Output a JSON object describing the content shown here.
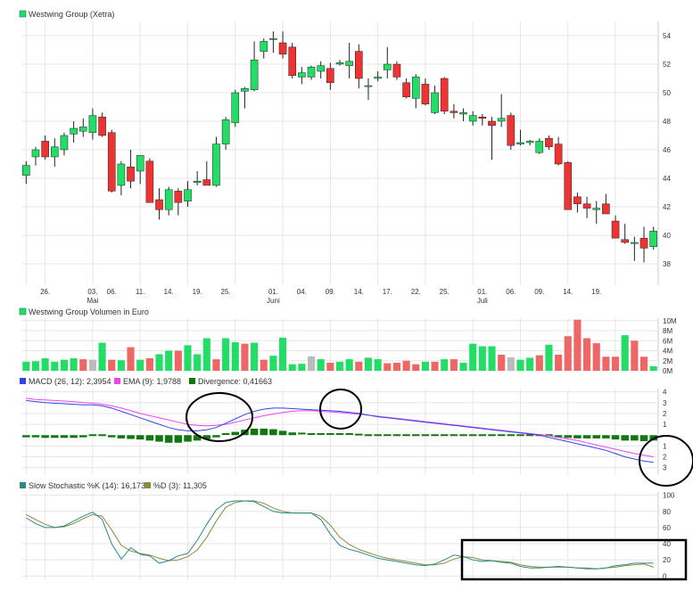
{
  "colors": {
    "up": "#22dd66",
    "down": "#ee3333",
    "neutral": "#bbbbbb",
    "grid": "#e6e6e6",
    "axis_text": "#333333",
    "macd_line": "#3344ee",
    "ema_line": "#ee44ee",
    "divergence": "#117711",
    "stoch_k": "#2a8a8a",
    "stoch_d": "#8a8a3a",
    "annotation": "#000000"
  },
  "price": {
    "title": "Westwing Group (Xetra)",
    "ylim": [
      36.5,
      55
    ],
    "yticks": [
      "38",
      "40",
      "42",
      "44",
      "46",
      "48",
      "50",
      "52",
      "54"
    ],
    "ytick_values": [
      38,
      40,
      42,
      44,
      46,
      48,
      50,
      52,
      54
    ],
    "xlabels": [
      {
        "label": "26.",
        "i": 2
      },
      {
        "label": "03.",
        "i": 7
      },
      {
        "label": "06.",
        "i": 9
      },
      {
        "label": "11.",
        "i": 12
      },
      {
        "label": "14.",
        "i": 15
      },
      {
        "label": "19.",
        "i": 18
      },
      {
        "label": "25.",
        "i": 21
      },
      {
        "label": "01.",
        "i": 26
      },
      {
        "label": "04.",
        "i": 29
      },
      {
        "label": "09.",
        "i": 32
      },
      {
        "label": "14.",
        "i": 35
      },
      {
        "label": "17.",
        "i": 38
      },
      {
        "label": "22.",
        "i": 41
      },
      {
        "label": "25.",
        "i": 44
      },
      {
        "label": "01.",
        "i": 48
      },
      {
        "label": "06.",
        "i": 51
      },
      {
        "label": "09.",
        "i": 54
      },
      {
        "label": "14.",
        "i": 57
      },
      {
        "label": "19.",
        "i": 60
      }
    ],
    "month_labels": [
      {
        "label": "Mai",
        "i": 7
      },
      {
        "label": "Juni",
        "i": 26
      },
      {
        "label": "Juli",
        "i": 48
      }
    ]
  },
  "volume": {
    "title": "Westwing Group Volumen in Euro",
    "yticks": [
      "10M",
      "8M",
      "6M",
      "4M",
      "2M",
      "0M"
    ],
    "ytick_values": [
      10,
      8,
      6,
      4,
      2,
      0
    ],
    "ylim": [
      0,
      10.5
    ]
  },
  "macd": {
    "title_macd": "MACD (26, 12): 2,3954",
    "title_ema": "EMA (9): 1,9788",
    "title_div": "Divergence: 0,41663",
    "yticks": [
      "4",
      "3",
      "2",
      "1",
      "1",
      "2",
      "3"
    ],
    "ytick_values": [
      4,
      3,
      2,
      1,
      -1,
      -2,
      -3
    ],
    "ylim": [
      -3.6,
      4.3
    ]
  },
  "stoch": {
    "title_k": "Slow Stochastic %K (14): 16,173",
    "title_d": "%D (3): 11,305",
    "yticks": [
      "100",
      "80",
      "60",
      "40",
      "20",
      "0"
    ],
    "ytick_values": [
      100,
      80,
      60,
      40,
      20,
      0
    ],
    "ylim": [
      -4,
      104
    ]
  },
  "chart_data": {
    "type": "candlestick",
    "title": "Westwing Group (Xetra)",
    "ylim": [
      36.5,
      55
    ],
    "candles": [
      {
        "o": 44.2,
        "h": 45.2,
        "l": 43.6,
        "c": 44.9
      },
      {
        "o": 45.5,
        "h": 46.2,
        "l": 44.9,
        "c": 46.0
      },
      {
        "o": 46.6,
        "h": 47.0,
        "l": 45.3,
        "c": 45.5
      },
      {
        "o": 45.5,
        "h": 46.8,
        "l": 44.8,
        "c": 46.2
      },
      {
        "o": 46.0,
        "h": 47.2,
        "l": 45.6,
        "c": 47.0
      },
      {
        "o": 47.1,
        "h": 48.0,
        "l": 46.5,
        "c": 47.5
      },
      {
        "o": 47.3,
        "h": 48.2,
        "l": 46.9,
        "c": 47.6
      },
      {
        "o": 47.2,
        "h": 48.9,
        "l": 46.7,
        "c": 48.4
      },
      {
        "o": 48.3,
        "h": 48.6,
        "l": 46.9,
        "c": 47.0
      },
      {
        "o": 47.2,
        "h": 47.4,
        "l": 43.0,
        "c": 43.1
      },
      {
        "o": 43.5,
        "h": 45.2,
        "l": 42.8,
        "c": 45.0
      },
      {
        "o": 44.8,
        "h": 46.0,
        "l": 43.3,
        "c": 43.8
      },
      {
        "o": 44.5,
        "h": 45.6,
        "l": 43.6,
        "c": 45.6
      },
      {
        "o": 45.2,
        "h": 45.4,
        "l": 42.4,
        "c": 42.3
      },
      {
        "o": 42.5,
        "h": 43.3,
        "l": 41.1,
        "c": 41.8
      },
      {
        "o": 41.8,
        "h": 43.4,
        "l": 41.4,
        "c": 43.2
      },
      {
        "o": 43.1,
        "h": 43.3,
        "l": 41.4,
        "c": 42.3
      },
      {
        "o": 42.4,
        "h": 43.8,
        "l": 42.0,
        "c": 43.2
      },
      {
        "o": 43.7,
        "h": 44.5,
        "l": 43.5,
        "c": 43.8
      },
      {
        "o": 43.9,
        "h": 45.2,
        "l": 43.5,
        "c": 43.5
      },
      {
        "o": 43.5,
        "h": 46.9,
        "l": 43.4,
        "c": 46.4
      },
      {
        "o": 46.4,
        "h": 48.3,
        "l": 46.0,
        "c": 48.1
      },
      {
        "o": 47.9,
        "h": 50.2,
        "l": 47.6,
        "c": 50.0
      },
      {
        "o": 50.1,
        "h": 50.4,
        "l": 48.9,
        "c": 50.3
      },
      {
        "o": 50.2,
        "h": 53.6,
        "l": 50.1,
        "c": 52.3
      },
      {
        "o": 52.9,
        "h": 53.8,
        "l": 52.4,
        "c": 53.6
      },
      {
        "o": 53.8,
        "h": 54.3,
        "l": 52.8,
        "c": 53.8
      },
      {
        "o": 53.5,
        "h": 54.3,
        "l": 52.4,
        "c": 52.7
      },
      {
        "o": 53.2,
        "h": 53.5,
        "l": 51.0,
        "c": 51.2
      },
      {
        "o": 51.1,
        "h": 51.8,
        "l": 50.6,
        "c": 51.4
      },
      {
        "o": 51.1,
        "h": 51.9,
        "l": 50.9,
        "c": 51.8
      },
      {
        "o": 51.5,
        "h": 52.2,
        "l": 51.0,
        "c": 51.9
      },
      {
        "o": 51.7,
        "h": 52.1,
        "l": 50.2,
        "c": 50.7
      },
      {
        "o": 52.0,
        "h": 52.3,
        "l": 51.9,
        "c": 52.1
      },
      {
        "o": 51.9,
        "h": 53.5,
        "l": 51.0,
        "c": 52.2
      },
      {
        "o": 52.9,
        "h": 53.4,
        "l": 50.3,
        "c": 51.0
      },
      {
        "o": 50.5,
        "h": 51.0,
        "l": 49.5,
        "c": 50.5
      },
      {
        "o": 51.0,
        "h": 51.5,
        "l": 50.8,
        "c": 51.1
      },
      {
        "o": 51.6,
        "h": 53.2,
        "l": 51.0,
        "c": 52.0
      },
      {
        "o": 52.0,
        "h": 52.2,
        "l": 50.9,
        "c": 51.1
      },
      {
        "o": 50.7,
        "h": 51.0,
        "l": 49.6,
        "c": 49.7
      },
      {
        "o": 49.6,
        "h": 51.3,
        "l": 48.9,
        "c": 51.1
      },
      {
        "o": 50.6,
        "h": 51.0,
        "l": 49.1,
        "c": 49.2
      },
      {
        "o": 48.6,
        "h": 50.5,
        "l": 48.5,
        "c": 50.0
      },
      {
        "o": 51.0,
        "h": 51.1,
        "l": 48.5,
        "c": 48.7
      },
      {
        "o": 48.7,
        "h": 49.2,
        "l": 48.2,
        "c": 48.6
      },
      {
        "o": 48.5,
        "h": 48.9,
        "l": 48.0,
        "c": 48.6
      },
      {
        "o": 48.0,
        "h": 48.7,
        "l": 47.7,
        "c": 48.4
      },
      {
        "o": 48.3,
        "h": 48.5,
        "l": 47.7,
        "c": 48.2
      },
      {
        "o": 48.0,
        "h": 48.3,
        "l": 45.3,
        "c": 47.7
      },
      {
        "o": 48.0,
        "h": 49.9,
        "l": 47.6,
        "c": 48.2
      },
      {
        "o": 48.4,
        "h": 48.6,
        "l": 46.0,
        "c": 46.3
      },
      {
        "o": 46.4,
        "h": 47.4,
        "l": 46.3,
        "c": 46.5
      },
      {
        "o": 46.5,
        "h": 46.7,
        "l": 46.3,
        "c": 46.6
      },
      {
        "o": 45.8,
        "h": 46.8,
        "l": 45.7,
        "c": 46.6
      },
      {
        "o": 46.8,
        "h": 47.0,
        "l": 46.0,
        "c": 46.2
      },
      {
        "o": 46.4,
        "h": 46.9,
        "l": 44.9,
        "c": 45.0
      },
      {
        "o": 45.1,
        "h": 45.2,
        "l": 42.3,
        "c": 41.8
      },
      {
        "o": 42.7,
        "h": 43.0,
        "l": 41.6,
        "c": 42.2
      },
      {
        "o": 42.2,
        "h": 42.7,
        "l": 41.2,
        "c": 41.9
      },
      {
        "o": 41.8,
        "h": 42.4,
        "l": 40.8,
        "c": 41.9
      },
      {
        "o": 42.2,
        "h": 42.9,
        "l": 41.5,
        "c": 41.5
      },
      {
        "o": 41.0,
        "h": 41.4,
        "l": 39.8,
        "c": 39.8
      },
      {
        "o": 39.7,
        "h": 40.8,
        "l": 39.4,
        "c": 39.5
      },
      {
        "o": 39.5,
        "h": 39.9,
        "l": 38.2,
        "c": 39.5
      },
      {
        "o": 39.8,
        "h": 40.6,
        "l": 38.1,
        "c": 39.1
      },
      {
        "o": 39.2,
        "h": 40.6,
        "l": 39.0,
        "c": 40.3
      }
    ],
    "volume": [
      1.8,
      1.9,
      2.5,
      1.8,
      2.2,
      2.5,
      2.3,
      2.2,
      5.6,
      2.2,
      2.1,
      4.7,
      2.2,
      2.5,
      3.3,
      4.0,
      4.0,
      5.1,
      3.3,
      6.5,
      2.3,
      6.5,
      5.7,
      5.4,
      5.6,
      2.2,
      3.0,
      6.6,
      1.3,
      1.4,
      2.9,
      2.3,
      1.6,
      1.8,
      2.3,
      1.8,
      2.6,
      2.3,
      1.5,
      1.6,
      2.0,
      1.3,
      1.8,
      1.8,
      2.3,
      2.3,
      1.6,
      5.4,
      4.9,
      4.9,
      3.2,
      2.7,
      2.2,
      2.6,
      3.1,
      5.2,
      3.2,
      6.9,
      10.2,
      6.5,
      5.5,
      2.8,
      2.8,
      7.1,
      6.0,
      2.8,
      0.9
    ],
    "volume_dir": [
      "up",
      "up",
      "up",
      "up",
      "up",
      "up",
      "down",
      "neutral",
      "up",
      "down",
      "up",
      "down",
      "up",
      "down",
      "up",
      "up",
      "down",
      "up",
      "up",
      "up",
      "down",
      "up",
      "up",
      "down",
      "up",
      "down",
      "up",
      "up",
      "up",
      "up",
      "neutral",
      "up",
      "down",
      "up",
      "up",
      "down",
      "up",
      "up",
      "down",
      "down",
      "down",
      "down",
      "up",
      "down",
      "up",
      "down",
      "up",
      "up",
      "up",
      "up",
      "down",
      "neutral",
      "up",
      "up",
      "down",
      "up",
      "down",
      "down",
      "down",
      "down",
      "down",
      "down",
      "down",
      "up",
      "down",
      "down",
      "up"
    ],
    "macd": [
      3.2,
      3.1,
      3.0,
      2.95,
      2.9,
      2.85,
      2.8,
      2.8,
      2.7,
      2.5,
      2.2,
      1.9,
      1.6,
      1.3,
      1.0,
      0.7,
      0.5,
      0.4,
      0.4,
      0.5,
      0.7,
      1.1,
      1.5,
      1.9,
      2.2,
      2.4,
      2.5,
      2.5,
      2.45,
      2.4,
      2.35,
      2.3,
      2.25,
      2.2,
      2.1,
      2.0,
      1.85,
      1.7,
      1.6,
      1.5,
      1.4,
      1.3,
      1.2,
      1.1,
      1.0,
      0.9,
      0.8,
      0.7,
      0.6,
      0.5,
      0.4,
      0.3,
      0.2,
      0.1,
      0.0,
      -0.2,
      -0.4,
      -0.6,
      -0.8,
      -1.0,
      -1.2,
      -1.4,
      -1.7,
      -2.0,
      -2.2,
      -2.4,
      -2.5
    ],
    "ema": [
      3.4,
      3.3,
      3.25,
      3.2,
      3.15,
      3.1,
      3.0,
      2.95,
      2.85,
      2.7,
      2.5,
      2.25,
      2.0,
      1.8,
      1.6,
      1.4,
      1.2,
      1.0,
      0.9,
      0.85,
      0.9,
      1.0,
      1.2,
      1.4,
      1.6,
      1.8,
      1.95,
      2.1,
      2.2,
      2.25,
      2.25,
      2.2,
      2.15,
      2.1,
      2.0,
      1.95,
      1.85,
      1.75,
      1.65,
      1.55,
      1.45,
      1.35,
      1.25,
      1.15,
      1.05,
      0.95,
      0.85,
      0.75,
      0.65,
      0.55,
      0.45,
      0.35,
      0.25,
      0.15,
      0.05,
      -0.05,
      -0.2,
      -0.35,
      -0.5,
      -0.7,
      -0.9,
      -1.1,
      -1.3,
      -1.5,
      -1.7,
      -1.85,
      -2.0
    ],
    "divergence": [
      -0.2,
      -0.2,
      -0.25,
      -0.25,
      -0.25,
      -0.25,
      -0.2,
      -0.15,
      -0.15,
      -0.2,
      -0.3,
      -0.35,
      -0.4,
      -0.5,
      -0.6,
      -0.7,
      -0.7,
      -0.6,
      -0.5,
      -0.35,
      -0.2,
      0.1,
      0.3,
      0.5,
      0.6,
      0.6,
      0.55,
      0.4,
      0.25,
      0.15,
      0.1,
      0.1,
      0.1,
      0.1,
      0.1,
      0.05,
      0.0,
      -0.05,
      -0.05,
      -0.05,
      -0.05,
      -0.05,
      -0.05,
      -0.05,
      -0.05,
      -0.05,
      -0.05,
      -0.05,
      -0.05,
      -0.05,
      -0.05,
      -0.05,
      -0.05,
      -0.05,
      -0.05,
      -0.15,
      -0.2,
      -0.25,
      -0.3,
      -0.3,
      -0.3,
      -0.3,
      -0.4,
      -0.5,
      -0.5,
      -0.55,
      -0.5
    ],
    "stoch_k": [
      72,
      65,
      60,
      60,
      62,
      68,
      74,
      79,
      70,
      40,
      21,
      35,
      27,
      25,
      16,
      19,
      25,
      28,
      44,
      64,
      82,
      91,
      93,
      93,
      92,
      86,
      80,
      78,
      78,
      78,
      78,
      70,
      52,
      38,
      33,
      30,
      26,
      22,
      20,
      18,
      16,
      14,
      13,
      15,
      20,
      26,
      24,
      20,
      18,
      19,
      17,
      16,
      12,
      10,
      10,
      11,
      12,
      11,
      10,
      9,
      9,
      10,
      13,
      14,
      16,
      16,
      16
    ],
    "stoch_d": [
      76,
      70,
      64,
      60,
      61,
      65,
      71,
      76,
      74,
      57,
      38,
      31,
      28,
      26,
      22,
      19,
      20,
      24,
      32,
      48,
      68,
      85,
      91,
      93,
      93,
      90,
      84,
      80,
      78,
      78,
      78,
      74,
      63,
      48,
      39,
      33,
      29,
      25,
      22,
      20,
      18,
      16,
      14,
      14,
      16,
      21,
      24,
      23,
      20,
      19,
      18,
      17,
      14,
      12,
      11,
      11,
      11,
      11,
      10,
      10,
      9,
      10,
      11,
      13,
      14,
      15,
      11
    ]
  }
}
